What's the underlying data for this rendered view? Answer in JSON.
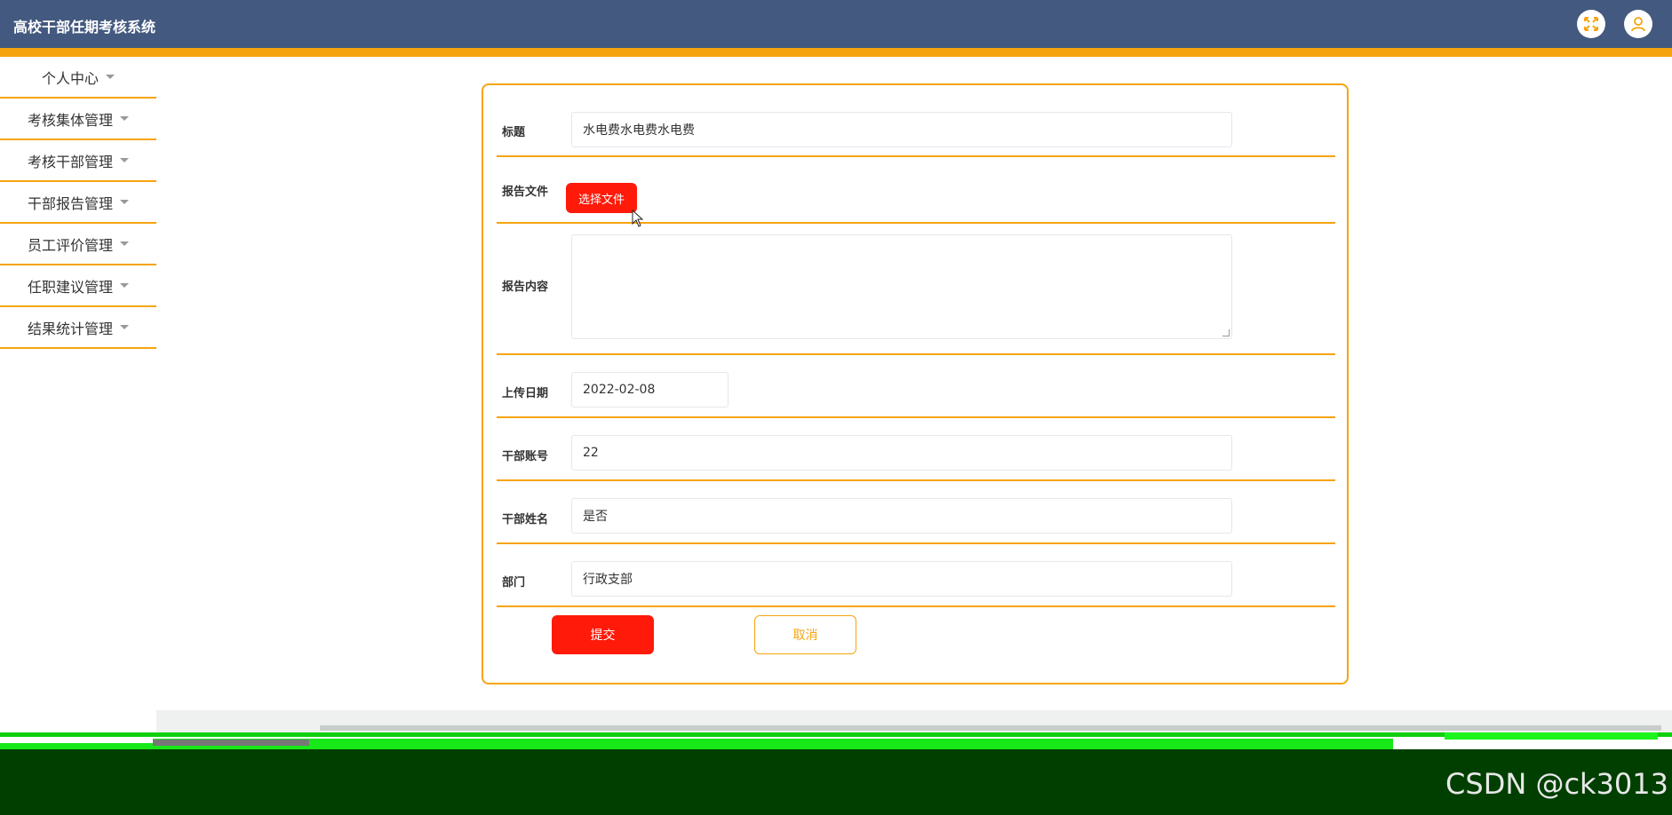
{
  "app": {
    "title": "高校干部任期考核系统"
  },
  "header": {
    "icons": [
      "fullscreen-icon",
      "user-icon"
    ]
  },
  "sidebar": {
    "items": [
      {
        "label": "个人中心"
      },
      {
        "label": "考核集体管理"
      },
      {
        "label": "考核干部管理"
      },
      {
        "label": "干部报告管理"
      },
      {
        "label": "员工评价管理"
      },
      {
        "label": "任职建议管理"
      },
      {
        "label": "结果统计管理"
      }
    ]
  },
  "form": {
    "title": {
      "label": "标题",
      "value": "水电费水电费水电费"
    },
    "report_file": {
      "label": "报告文件",
      "button": "选择文件"
    },
    "report_content": {
      "label": "报告内容",
      "value": ""
    },
    "upload_date": {
      "label": "上传日期",
      "value": "2022-02-08"
    },
    "cadre_account": {
      "label": "干部账号",
      "value": "22"
    },
    "cadre_name": {
      "label": "干部姓名",
      "value": "是否"
    },
    "department": {
      "label": "部门",
      "value": "行政支部"
    },
    "submit_label": "提交",
    "cancel_label": "取消"
  },
  "watermark": "CSDN @ck3013",
  "colors": {
    "header": "#43597f",
    "accent": "#f5a410",
    "primary_button": "#ff1a0a"
  }
}
